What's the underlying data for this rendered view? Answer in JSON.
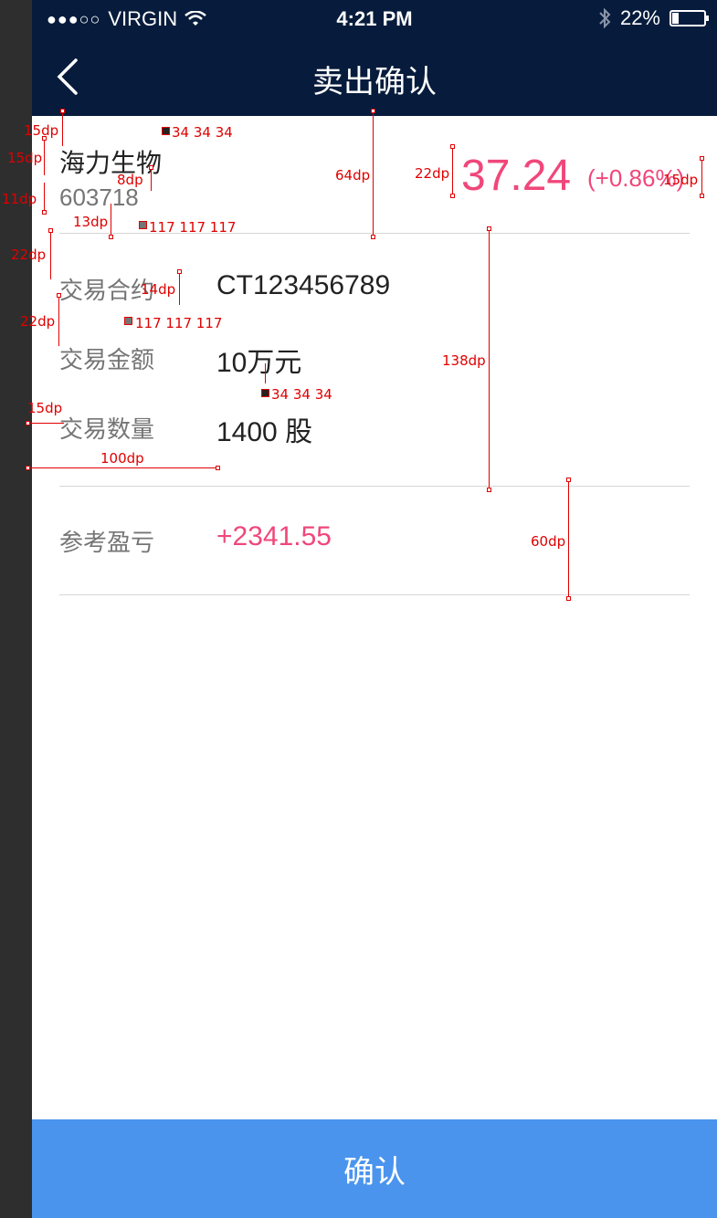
{
  "status_bar": {
    "carrier": "VIRGIN",
    "signal": "●●●○○",
    "time": "4:21 PM",
    "battery": "22%",
    "battery_level": 0.22
  },
  "nav": {
    "title": "卖出确认"
  },
  "stock": {
    "name": "海力生物",
    "code": "603718",
    "price": "37.24",
    "change": "(+0.86%)"
  },
  "details": [
    {
      "label": "交易合约",
      "value": "CT123456789"
    },
    {
      "label": "交易金额",
      "value": "10万元"
    },
    {
      "label": "交易数量",
      "value": "1400 股"
    }
  ],
  "profit": {
    "label": "参考盈亏",
    "value": "+2341.55"
  },
  "confirm_label": "确认",
  "annotations": {
    "dp15a": "15dp",
    "dp15b": "15dp",
    "dp11": "11dp",
    "dp13": "13dp",
    "dp8": "8dp",
    "dp22a": "22dp",
    "dp14": "14dp",
    "dp22b": "22dp",
    "dp15c": "15dp",
    "dp100": "100dp",
    "dp64": "64dp",
    "dp22c": "22dp",
    "dp15d": "15dp",
    "dp138": "138dp",
    "dp60": "60dp",
    "c1": "34 34 34",
    "c2": "117 117 117",
    "c3": "117 117 117",
    "c4": "34 34 34"
  },
  "colors": {
    "nav_bg": "#071c3c",
    "accent": "#f0477b",
    "button": "#4a94ee",
    "dark_text": "#222222",
    "gray_text": "#757575"
  }
}
